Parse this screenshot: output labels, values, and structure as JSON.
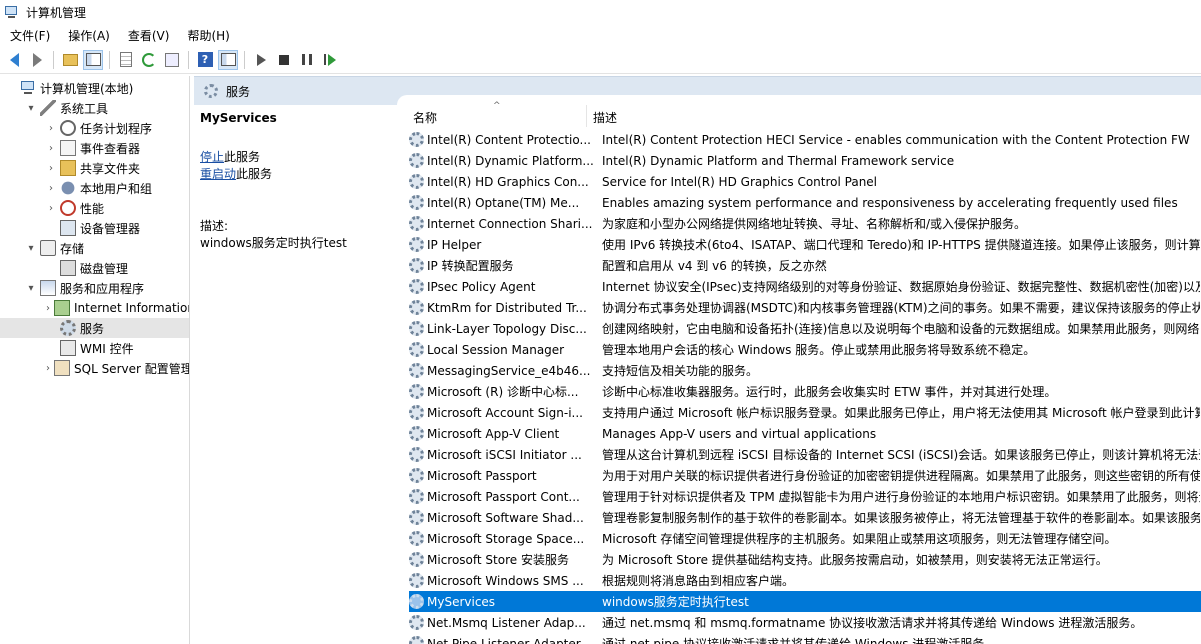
{
  "window": {
    "title": "计算机管理"
  },
  "menu": [
    "文件(F)",
    "操作(A)",
    "查看(V)",
    "帮助(H)"
  ],
  "tree": {
    "items": [
      {
        "label": "计算机管理(本地)",
        "level": 0,
        "expander": "",
        "icon": "computer-icon"
      },
      {
        "label": "系统工具",
        "level": 1,
        "expander": "▾",
        "icon": "tools-icon"
      },
      {
        "label": "任务计划程序",
        "level": 2,
        "expander": "›",
        "icon": "clock-icon"
      },
      {
        "label": "事件查看器",
        "level": 2,
        "expander": "›",
        "icon": "event-viewer-icon"
      },
      {
        "label": "共享文件夹",
        "level": 2,
        "expander": "›",
        "icon": "shared-folder-icon"
      },
      {
        "label": "本地用户和组",
        "level": 2,
        "expander": "›",
        "icon": "users-icon"
      },
      {
        "label": "性能",
        "level": 2,
        "expander": "›",
        "icon": "performance-icon"
      },
      {
        "label": "设备管理器",
        "level": 2,
        "expander": "",
        "icon": "device-manager-icon"
      },
      {
        "label": "存储",
        "level": 1,
        "expander": "▾",
        "icon": "storage-icon"
      },
      {
        "label": "磁盘管理",
        "level": 2,
        "expander": "",
        "icon": "disk-icon"
      },
      {
        "label": "服务和应用程序",
        "level": 1,
        "expander": "▾",
        "icon": "apps-icon"
      },
      {
        "label": "Internet Information Services",
        "level": 2,
        "expander": "›",
        "icon": "iis-icon"
      },
      {
        "label": "服务",
        "level": 2,
        "expander": "",
        "icon": "services-gear-icon",
        "selected": true
      },
      {
        "label": "WMI 控件",
        "level": 2,
        "expander": "",
        "icon": "wmi-icon"
      },
      {
        "label": "SQL Server 配置管理器",
        "level": 2,
        "expander": "›",
        "icon": "sql-icon"
      }
    ]
  },
  "services_header": "服务",
  "selected_service": {
    "name": "MyServices",
    "stop_link": "停止",
    "stop_suffix": "此服务",
    "restart_link": "重启动",
    "restart_suffix": "此服务",
    "desc_label": "描述:",
    "desc_text": "windows服务定时执行test"
  },
  "list": {
    "col_name": "名称",
    "col_desc": "描述",
    "rows": [
      {
        "name": "Intel(R) Content Protectio...",
        "desc": "Intel(R) Content Protection HECI Service - enables communication with the Content Protection FW"
      },
      {
        "name": "Intel(R) Dynamic Platform...",
        "desc": "Intel(R) Dynamic Platform and Thermal Framework service"
      },
      {
        "name": "Intel(R) HD Graphics Con...",
        "desc": "Service for Intel(R) HD Graphics Control Panel"
      },
      {
        "name": "Intel(R) Optane(TM) Me...",
        "desc": "Enables amazing system performance and responsiveness by accelerating frequently used files"
      },
      {
        "name": "Internet Connection Shari...",
        "desc": "为家庭和小型办公网络提供网络地址转换、寻址、名称解析和/或入侵保护服务。"
      },
      {
        "name": "IP Helper",
        "desc": "使用 IPv6 转换技术(6to4、ISATAP、端口代理和 Teredo)和 IP-HTTPS 提供隧道连接。如果停止该服务，则计算机"
      },
      {
        "name": "IP 转换配置服务",
        "desc": "配置和启用从 v4 到 v6 的转换，反之亦然"
      },
      {
        "name": "IPsec Policy Agent",
        "desc": "Internet 协议安全(IPsec)支持网络级别的对等身份验证、数据原始身份验证、数据完整性、数据机密性(加密)以及重"
      },
      {
        "name": "KtmRm for Distributed Tr...",
        "desc": "协调分布式事务处理协调器(MSDTC)和内核事务管理器(KTM)之间的事务。如果不需要，建议保持该服务的停止状态"
      },
      {
        "name": "Link-Layer Topology Disc...",
        "desc": "创建网络映射，它由电脑和设备拓扑(连接)信息以及说明每个电脑和设备的元数据组成。如果禁用此服务，则网络映"
      },
      {
        "name": "Local Session Manager",
        "desc": "管理本地用户会话的核心 Windows 服务。停止或禁用此服务将导致系统不稳定。"
      },
      {
        "name": "MessagingService_e4b46...",
        "desc": "支持短信及相关功能的服务。"
      },
      {
        "name": "Microsoft (R) 诊断中心标...",
        "desc": "诊断中心标准收集器服务。运行时，此服务会收集实时 ETW 事件，并对其进行处理。"
      },
      {
        "name": "Microsoft Account Sign-i...",
        "desc": "支持用户通过 Microsoft 帐户标识服务登录。如果此服务已停止，用户将无法使用其 Microsoft 帐户登录到此计算"
      },
      {
        "name": "Microsoft App-V Client",
        "desc": "Manages App-V users and virtual applications"
      },
      {
        "name": "Microsoft iSCSI Initiator ...",
        "desc": "管理从这台计算机到远程 iSCSI 目标设备的 Internet SCSI (iSCSI)会话。如果该服务已停止，则该计算机将无法登录"
      },
      {
        "name": "Microsoft Passport",
        "desc": "为用于对用户关联的标识提供者进行身份验证的加密密钥提供进程隔离。如果禁用了此服务，则这些密钥的所有使用"
      },
      {
        "name": "Microsoft Passport Cont...",
        "desc": "管理用于针对标识提供者及 TPM 虚拟智能卡为用户进行身份验证的本地用户标识密钥。如果禁用了此服务，则将无"
      },
      {
        "name": "Microsoft Software Shad...",
        "desc": "管理卷影复制服务制作的基于软件的卷影副本。如果该服务被停止，将无法管理基于软件的卷影副本。如果该服务被"
      },
      {
        "name": "Microsoft Storage Space...",
        "desc": "Microsoft 存储空间管理提供程序的主机服务。如果阻止或禁用这项服务，则无法管理存储空间。"
      },
      {
        "name": "Microsoft Store 安装服务",
        "desc": "为 Microsoft Store 提供基础结构支持。此服务按需启动，如被禁用，则安装将无法正常运行。"
      },
      {
        "name": "Microsoft Windows SMS ...",
        "desc": "根据规则将消息路由到相应客户端。"
      },
      {
        "name": "MyServices",
        "desc": "windows服务定时执行test",
        "selected": true
      },
      {
        "name": "Net.Msmq Listener Adap...",
        "desc": "通过 net.msmq 和 msmq.formatname 协议接收激活请求并将其传递给 Windows 进程激活服务。"
      },
      {
        "name": "Net.Pipe Listener Adapter",
        "desc": "通过 net.pipe 协议接收激活请求并将其传递给 Windows 进程激活服务。"
      }
    ]
  },
  "colors": {
    "selection": "#0078d7",
    "header_band": "#dde7f2",
    "link": "#1a4fa3"
  }
}
